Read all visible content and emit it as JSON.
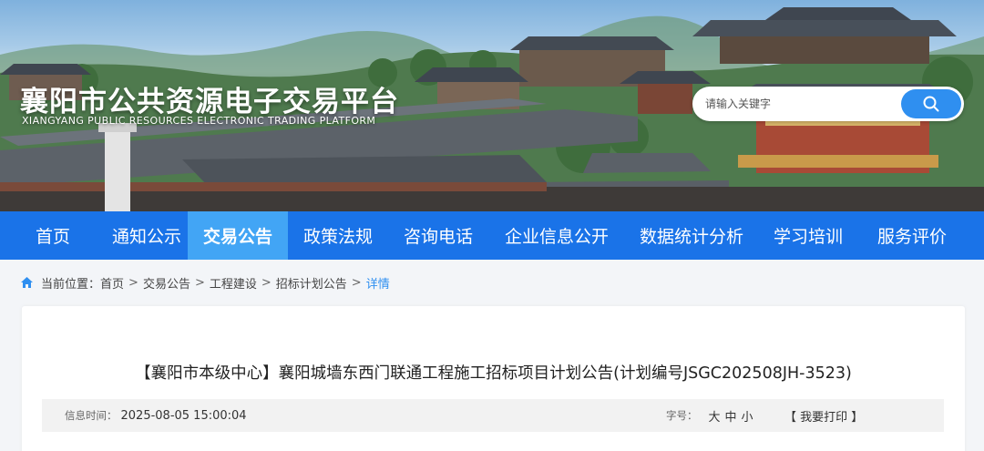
{
  "header": {
    "site_title": "襄阳市公共资源电子交易平台",
    "site_subtitle": "XIANGYANG PUBLIC RESOURCES ELECTRONIC TRADING PLATFORM"
  },
  "search": {
    "placeholder": "请输入关键字",
    "icon": "search-icon"
  },
  "nav": {
    "items": [
      "首页",
      "通知公示",
      "交易公告",
      "政策法规",
      "咨询电话",
      "企业信息公开",
      "数据统计分析",
      "学习培训",
      "服务评价"
    ],
    "active": "交易公告"
  },
  "breadcrumb": {
    "icon": "home-icon",
    "prefix": "当前位置：",
    "items": [
      "首页",
      "交易公告",
      "工程建设",
      "招标计划公告",
      "详情"
    ],
    "separator": ">"
  },
  "article": {
    "title": "【襄阳市本级中心】襄阳城墙东西门联通工程施工招标项目计划公告(计划编号JSGC202508JH-3523)",
    "info_label": "信息时间：",
    "info_time": "2025-08-05 15:00:04",
    "font_size_label": "字号：",
    "font_sizes": [
      "大",
      "中",
      "小"
    ],
    "print_label": "【 我要打印 】"
  },
  "colors": {
    "nav_bg": "#1a73e8",
    "nav_active": "#42a5f5",
    "accent": "#2f8ff0"
  }
}
